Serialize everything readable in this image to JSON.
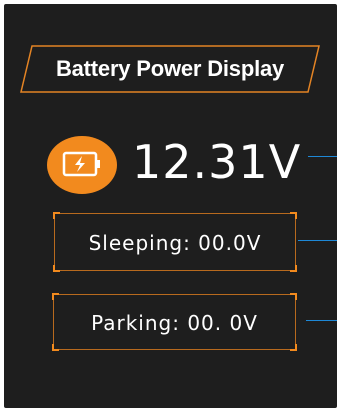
{
  "header": {
    "title": "Battery Power Display"
  },
  "battery": {
    "icon": "battery-charging-icon",
    "voltage": "12.31V"
  },
  "modes": {
    "sleeping": "Sleeping: 00.0V",
    "parking": "Parking: 00. 0V"
  },
  "colors": {
    "background": "#1e1e1e",
    "accent_orange": "#f28a1e",
    "frame_orange": "#b86a1e",
    "connector_blue": "#1e88d6",
    "text": "#ffffff"
  }
}
